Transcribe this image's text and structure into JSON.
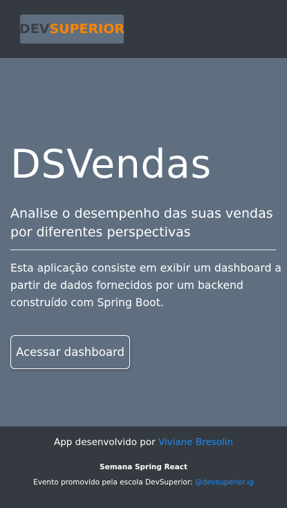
{
  "navbar": {
    "logo_dev": "DEV",
    "logo_superior": "SUPERIOR"
  },
  "hero": {
    "title": "DSVendas",
    "lead": "Analise o desempenho das suas vendas por diferentes perspectivas",
    "description": "Esta aplicação consiste em exibir um dashboard a partir de dados fornecidos por um backend construído com Spring Boot.",
    "button_label": "Acessar dashboard"
  },
  "footer": {
    "developed_by_prefix": "App desenvolvido por ",
    "developer_name": "Viviane Bresolin",
    "event_title": "Semana Spring React",
    "promoted_prefix": "Evento promovido pela escola DevSuperior: ",
    "instagram_handle": "@devsuperior.ig"
  },
  "colors": {
    "background": "#5f6f80",
    "navbar": "#343a40",
    "brand_orange": "#ff8400",
    "link_blue": "#1a8cff"
  }
}
